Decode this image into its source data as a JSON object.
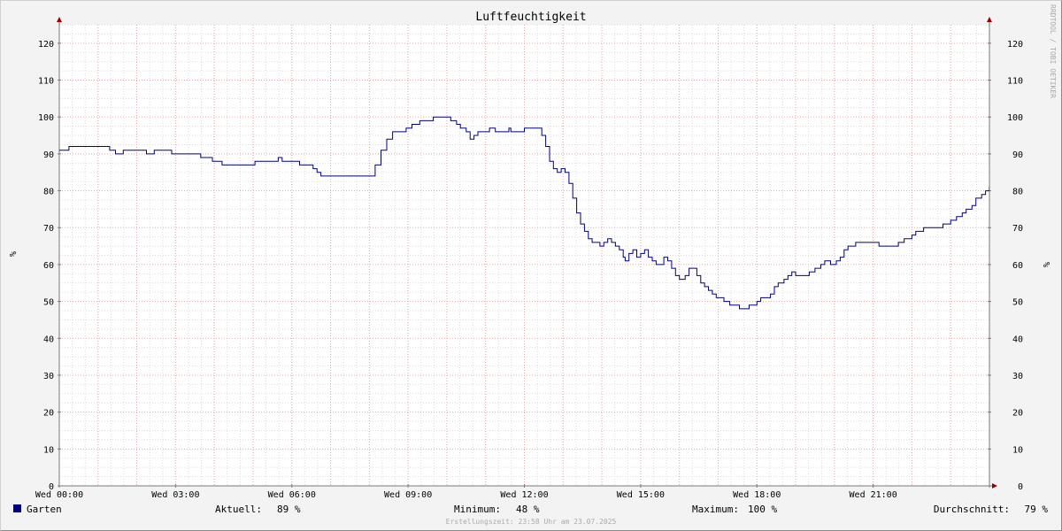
{
  "chart_data": {
    "type": "line",
    "title": "Luftfeuchtigkeit",
    "ylabel": "%",
    "ylabel_right": "%",
    "ylim": [
      0,
      125
    ],
    "yticks": [
      0,
      10,
      20,
      30,
      40,
      50,
      60,
      70,
      80,
      90,
      100,
      110,
      120
    ],
    "xlim": [
      0,
      24
    ],
    "xticks": [
      {
        "x": 0,
        "label": "Wed 00:00"
      },
      {
        "x": 3,
        "label": "Wed 03:00"
      },
      {
        "x": 6,
        "label": "Wed 06:00"
      },
      {
        "x": 9,
        "label": "Wed 09:00"
      },
      {
        "x": 12,
        "label": "Wed 12:00"
      },
      {
        "x": 15,
        "label": "Wed 15:00"
      },
      {
        "x": 18,
        "label": "Wed 18:00"
      },
      {
        "x": 21,
        "label": "Wed 21:00"
      }
    ],
    "grid": true,
    "series": [
      {
        "name": "Garten",
        "color": "#000080",
        "points": [
          [
            0.0,
            91
          ],
          [
            0.25,
            92
          ],
          [
            1.25,
            92
          ],
          [
            1.3,
            91
          ],
          [
            1.45,
            90
          ],
          [
            1.65,
            91
          ],
          [
            2.2,
            91
          ],
          [
            2.25,
            90
          ],
          [
            2.45,
            91
          ],
          [
            2.85,
            91
          ],
          [
            2.9,
            90
          ],
          [
            3.6,
            90
          ],
          [
            3.65,
            89
          ],
          [
            3.95,
            88
          ],
          [
            4.2,
            87
          ],
          [
            5.0,
            87
          ],
          [
            5.05,
            88
          ],
          [
            5.55,
            88
          ],
          [
            5.65,
            89
          ],
          [
            5.75,
            88
          ],
          [
            6.15,
            88
          ],
          [
            6.2,
            87
          ],
          [
            6.45,
            87
          ],
          [
            6.55,
            86
          ],
          [
            6.65,
            85
          ],
          [
            6.75,
            84
          ],
          [
            8.05,
            84
          ],
          [
            8.15,
            87
          ],
          [
            8.3,
            91
          ],
          [
            8.45,
            94
          ],
          [
            8.6,
            96
          ],
          [
            8.8,
            96
          ],
          [
            8.95,
            97
          ],
          [
            9.1,
            98
          ],
          [
            9.3,
            99
          ],
          [
            9.55,
            99
          ],
          [
            9.65,
            100
          ],
          [
            10.0,
            100
          ],
          [
            10.1,
            99
          ],
          [
            10.25,
            98
          ],
          [
            10.35,
            97
          ],
          [
            10.5,
            96
          ],
          [
            10.6,
            94
          ],
          [
            10.7,
            95
          ],
          [
            10.8,
            96
          ],
          [
            11.05,
            96
          ],
          [
            11.1,
            97
          ],
          [
            11.25,
            96
          ],
          [
            11.55,
            96
          ],
          [
            11.6,
            97
          ],
          [
            11.65,
            96
          ],
          [
            11.95,
            96
          ],
          [
            12.0,
            97
          ],
          [
            12.35,
            97
          ],
          [
            12.45,
            95
          ],
          [
            12.55,
            92
          ],
          [
            12.65,
            88
          ],
          [
            12.75,
            86
          ],
          [
            12.85,
            85
          ],
          [
            12.95,
            86
          ],
          [
            13.05,
            85
          ],
          [
            13.15,
            82
          ],
          [
            13.25,
            78
          ],
          [
            13.35,
            74
          ],
          [
            13.45,
            71
          ],
          [
            13.55,
            69
          ],
          [
            13.65,
            67
          ],
          [
            13.75,
            66
          ],
          [
            13.95,
            65
          ],
          [
            14.05,
            66
          ],
          [
            14.15,
            67
          ],
          [
            14.25,
            66
          ],
          [
            14.35,
            65
          ],
          [
            14.45,
            64
          ],
          [
            14.55,
            62
          ],
          [
            14.6,
            61
          ],
          [
            14.7,
            63
          ],
          [
            14.8,
            64
          ],
          [
            14.9,
            62
          ],
          [
            15.0,
            63
          ],
          [
            15.1,
            64
          ],
          [
            15.2,
            62
          ],
          [
            15.3,
            61
          ],
          [
            15.4,
            60
          ],
          [
            15.5,
            60
          ],
          [
            15.6,
            62
          ],
          [
            15.7,
            61
          ],
          [
            15.8,
            59
          ],
          [
            15.9,
            57
          ],
          [
            16.0,
            56
          ],
          [
            16.15,
            57
          ],
          [
            16.25,
            59
          ],
          [
            16.35,
            59
          ],
          [
            16.45,
            57
          ],
          [
            16.55,
            55
          ],
          [
            16.65,
            54
          ],
          [
            16.75,
            53
          ],
          [
            16.85,
            52
          ],
          [
            16.95,
            51
          ],
          [
            17.05,
            51
          ],
          [
            17.15,
            50
          ],
          [
            17.3,
            49
          ],
          [
            17.45,
            49
          ],
          [
            17.55,
            48
          ],
          [
            17.7,
            48
          ],
          [
            17.8,
            49
          ],
          [
            17.9,
            49
          ],
          [
            18.0,
            50
          ],
          [
            18.1,
            51
          ],
          [
            18.25,
            51
          ],
          [
            18.35,
            52
          ],
          [
            18.45,
            54
          ],
          [
            18.55,
            55
          ],
          [
            18.7,
            56
          ],
          [
            18.8,
            57
          ],
          [
            18.9,
            58
          ],
          [
            19.0,
            57
          ],
          [
            19.25,
            57
          ],
          [
            19.35,
            58
          ],
          [
            19.5,
            59
          ],
          [
            19.65,
            60
          ],
          [
            19.75,
            61
          ],
          [
            19.9,
            60
          ],
          [
            20.05,
            61
          ],
          [
            20.15,
            62
          ],
          [
            20.25,
            64
          ],
          [
            20.35,
            65
          ],
          [
            20.55,
            66
          ],
          [
            21.1,
            66
          ],
          [
            21.15,
            65
          ],
          [
            21.6,
            65
          ],
          [
            21.65,
            66
          ],
          [
            21.8,
            67
          ],
          [
            22.0,
            68
          ],
          [
            22.1,
            69
          ],
          [
            22.3,
            70
          ],
          [
            22.7,
            70
          ],
          [
            22.8,
            71
          ],
          [
            23.0,
            72
          ],
          [
            23.15,
            73
          ],
          [
            23.3,
            74
          ],
          [
            23.4,
            75
          ],
          [
            23.55,
            76
          ],
          [
            23.65,
            78
          ],
          [
            23.8,
            79
          ],
          [
            23.9,
            80
          ],
          [
            24.0,
            81
          ],
          [
            24.2,
            82
          ],
          [
            24.4,
            83
          ],
          [
            24.55,
            84
          ],
          [
            24.7,
            85
          ],
          [
            24.85,
            86
          ],
          [
            25.0,
            87
          ],
          [
            25.15,
            88
          ],
          [
            25.25,
            89
          ]
        ]
      }
    ]
  },
  "watermark": "RRDTOOL / TOBI OETIKER",
  "legend": {
    "series_name": "Garten",
    "swatch_color": "#000080",
    "current_label": "Aktuell:",
    "current_value": "89 %",
    "min_label": "Minimum:",
    "min_value": "48 %",
    "max_label": "Maximum:",
    "max_value": "100 %",
    "avg_label": "Durchschnitt:",
    "avg_value": "79 %"
  },
  "created": "Erstellungszeit: 23:58 Uhr am 23.07.2025",
  "colors": {
    "canvas": "#ffffff",
    "background": "#f3f3f3",
    "minor_grid": "#dcdcdc",
    "major_grid": "#e8a8a8",
    "axis": "#7a7a7a",
    "arrow": "#990000",
    "line": "#000080"
  }
}
